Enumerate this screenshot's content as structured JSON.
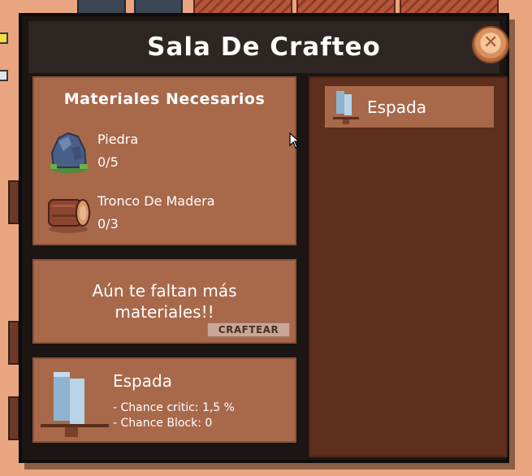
{
  "window": {
    "title": "Sala De Crafteo"
  },
  "materials": {
    "title": "Materiales Necesarios",
    "items": [
      {
        "name": "Piedra",
        "count": "0/5",
        "icon": "stone-icon"
      },
      {
        "name": "Tronco De Madera",
        "count": "0/3",
        "icon": "log-icon"
      }
    ]
  },
  "message": {
    "text": "Aún te faltan más materiales!!",
    "craft_label": "CRAFTEAR"
  },
  "result": {
    "name": "Espada",
    "stats": [
      "- Chance critic: 1,5 %",
      "- Chance Block: 0"
    ],
    "icon": "sword-icon"
  },
  "recipes": [
    {
      "label": "Espada",
      "icon": "sword-icon"
    }
  ],
  "colors": {
    "panel": "#a8684a",
    "window": "#1b1613",
    "recipe_list": "#5d2f1c",
    "background": "#e9a57f"
  }
}
